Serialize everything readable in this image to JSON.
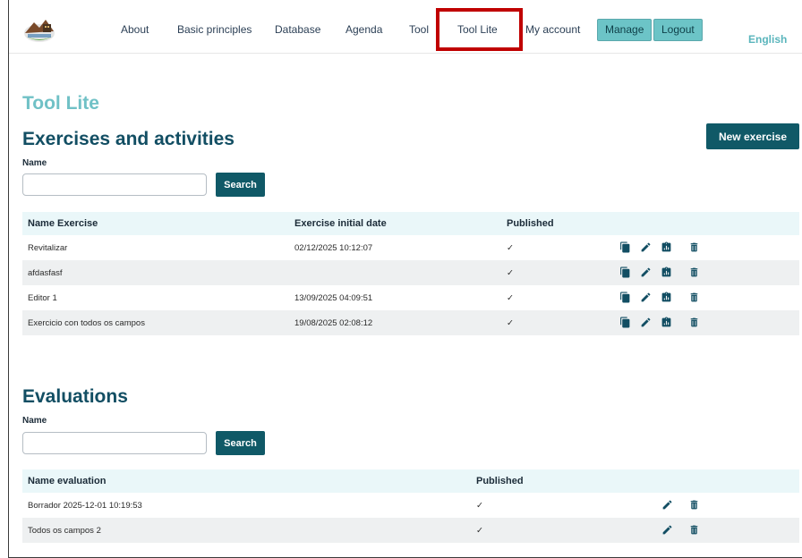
{
  "nav": {
    "items": [
      {
        "label": "About"
      },
      {
        "label": "Basic principles"
      },
      {
        "label": "Database"
      },
      {
        "label": "Agenda"
      },
      {
        "label": "Tool"
      },
      {
        "label": "Tool Lite"
      },
      {
        "label": "My account"
      }
    ],
    "manage_label": "Manage",
    "logout_label": "Logout",
    "language": "English"
  },
  "page_title": "Tool Lite",
  "exercises": {
    "title": "Exercises and activities",
    "new_button": "New exercise",
    "name_label": "Name",
    "search_value": "",
    "search_button": "Search",
    "columns": [
      "Name Exercise",
      "Exercise initial date",
      "Published"
    ],
    "rows": [
      {
        "name": "Revitalizar",
        "date": "02/12/2025 10:12:07",
        "published": "✓"
      },
      {
        "name": "afdasfasf",
        "date": "",
        "published": "✓"
      },
      {
        "name": "Editor 1",
        "date": "13/09/2025 04:09:51",
        "published": "✓"
      },
      {
        "name": "Exercicio con todos os campos",
        "date": "19/08/2025 02:08:12",
        "published": "✓"
      }
    ]
  },
  "evaluations": {
    "title": "Evaluations",
    "name_label": "Name",
    "search_value": "",
    "search_button": "Search",
    "columns": [
      "Name evaluation",
      "Published"
    ],
    "rows": [
      {
        "name": "Borrador 2025-12-01 10:19:53",
        "published": "✓"
      },
      {
        "name": "Todos os campos 2",
        "published": "✓"
      }
    ]
  },
  "colors": {
    "brand_dark": "#105967",
    "brand_light": "#6cc4c7",
    "highlight_box": "#c00000"
  },
  "icons": [
    "copy-icon",
    "edit-icon",
    "report-icon",
    "delete-icon"
  ]
}
